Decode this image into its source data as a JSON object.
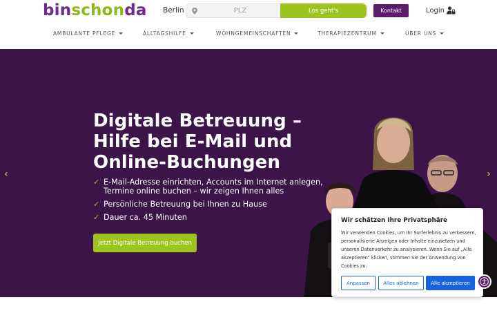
{
  "header": {
    "logo": {
      "part1": "bin",
      "part2": "schon",
      "part3": "da"
    },
    "city": "Berlin",
    "plz_placeholder": "PLZ",
    "go_label": "Los geht's",
    "kontakt_label": "Kontakt",
    "login_label": "Login"
  },
  "nav": {
    "items": [
      {
        "label": "AMBULANTE PFLEGE"
      },
      {
        "label": "ALLTAGSHILFE"
      },
      {
        "label": "WOHNGEMEINSCHAFTEN"
      },
      {
        "label": "THERAPIEZENTRUM"
      },
      {
        "label": "ÜBER UNS"
      }
    ]
  },
  "hero": {
    "title_line1": "Digitale Betreuung –",
    "title_line2": "Hilfe bei E-Mail und",
    "title_line3": "Online-Buchungen",
    "check_glyph": "✓",
    "bullets": [
      "E-Mail-Adresse einrichten, Accounts im Internet anlegen, Termine online buchen – wir zeigen Ihnen alles",
      "Persönliche Betreuung bei Ihnen zu Hause",
      "Dauer ca. 45 Minuten"
    ],
    "cta_label": "Jetzt Digitale Betreuung buchen",
    "arrow_left": "‹",
    "arrow_right": "›"
  },
  "cookie": {
    "title": "Wir schätzen Ihre Privatsphäre",
    "text": "Wir verwenden Cookies, um Ihr Surferlebnis zu verbessern, personalisierte Anzeigen oder Inhalte einzusetzen und unseren Datenverkehr zu analysieren. Wenn Sie auf „Alle akzeptieren“ klicken, stimmen Sie der Anwendung von Cookies zu.",
    "customize_label": "Anpassen",
    "reject_label": "Alles ablehnen",
    "accept_label": "Alle akzeptieren"
  },
  "colors": {
    "brand_purple": "#5a1b6b",
    "brand_green": "#9cc31e",
    "hero_bg": "#3d1448",
    "cookie_blue": "#1863dc"
  },
  "icons": {
    "pin": "map-pin-icon",
    "login": "user-lock-icon",
    "accessibility": "accessibility-icon"
  }
}
